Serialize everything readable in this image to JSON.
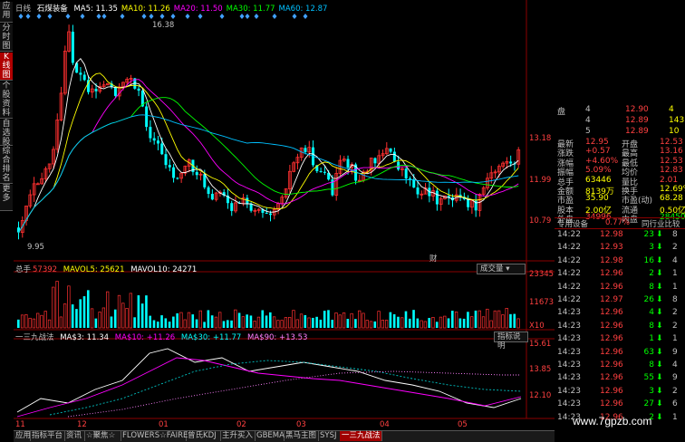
{
  "sidebar": {
    "tabs": [
      {
        "label": "应用",
        "active": false
      },
      {
        "label": "分时图",
        "active": false
      },
      {
        "label": "K线图",
        "active": true
      },
      {
        "label": "个股资料",
        "active": false
      },
      {
        "label": "自选股",
        "active": false
      },
      {
        "label": "综合排名",
        "active": false
      },
      {
        "label": "更多",
        "active": false
      }
    ]
  },
  "main": {
    "period": "日线",
    "stock_name": "石煤装备",
    "ma": [
      {
        "label": "MA5: 11.35",
        "color": "#ffffff"
      },
      {
        "label": "MA10: 11.26",
        "color": "#ffff00"
      },
      {
        "label": "MA20: 11.50",
        "color": "#ff00ff"
      },
      {
        "label": "MA30: 11.77",
        "color": "#00ff00"
      },
      {
        "label": "MA60: 12.87",
        "color": "#00c0ff"
      }
    ],
    "high_label": "16.38",
    "low_label": "9.95",
    "price_axis": [
      "13.18",
      "11.99",
      "10.79"
    ],
    "marker_text": "财"
  },
  "volume": {
    "label": "总手",
    "value": "57392",
    "mavol5": "MAVOL5: 25621",
    "mavol10": "MAVOL10: 24271",
    "dropdown": "成交量",
    "axis": [
      "23345",
      "11673",
      "X10"
    ]
  },
  "indicator": {
    "name": "一三九战法",
    "ma3": "MA$3: 11.34",
    "ma10": "MA$10: +11.26",
    "ma30": "MA$30: +11.77",
    "ma90": "MA$90: +13.53",
    "dropdown": "指标说明",
    "axis": [
      "15.61",
      "13.85",
      "12.10"
    ]
  },
  "time_axis": [
    "11",
    "12",
    "01",
    "02",
    "03",
    "04",
    "05"
  ],
  "bottom_tabs": [
    {
      "label": "应用",
      "active": false
    },
    {
      "label": "指标平台",
      "active": false
    },
    {
      "label": "资讯",
      "active": false
    },
    {
      "label": "☆聚焦☆",
      "active": false
    },
    {
      "label": "FLOWERS☆FAIRE",
      "active": false
    },
    {
      "label": "曾氏KDJ",
      "active": false
    },
    {
      "label": "主升买入",
      "active": false
    },
    {
      "label": "GBEMA",
      "active": false
    },
    {
      "label": "黑马主图",
      "active": false
    },
    {
      "label": "SYSJ",
      "active": false
    },
    {
      "label": "一三九战法",
      "active": true
    }
  ],
  "quote": {
    "orderbook": [
      {
        "label": "盘",
        "num": "4",
        "price": "12.90",
        "vol": "4"
      },
      {
        "label": "",
        "num": "4",
        "price": "12.89",
        "vol": "143"
      },
      {
        "label": "",
        "num": "5",
        "price": "12.89",
        "vol": "10"
      }
    ],
    "rows": [
      {
        "l1": "最新",
        "v1": "12.95",
        "l2": "开盘",
        "v2": "12.53",
        "c1": "#ff4040",
        "c2": "#ff4040"
      },
      {
        "l1": "涨跌",
        "v1": "+0.57",
        "l2": "最高",
        "v2": "13.16",
        "c1": "#ff4040",
        "c2": "#ff4040"
      },
      {
        "l1": "涨幅",
        "v1": "+4.60%",
        "l2": "最低",
        "v2": "12.53",
        "c1": "#ff4040",
        "c2": "#ff4040"
      },
      {
        "l1": "振幅",
        "v1": "5.09%",
        "l2": "均价",
        "v2": "12.83",
        "c1": "#ff4040",
        "c2": "#ff4040"
      },
      {
        "l1": "总手",
        "v1": "63446",
        "l2": "量比",
        "v2": "2.01",
        "c1": "#ffff00",
        "c2": "#ff4040"
      },
      {
        "l1": "金额",
        "v1": "8139万",
        "l2": "换手",
        "v2": "12.69%",
        "c1": "#ffff00",
        "c2": "#ffff00"
      },
      {
        "l1": "市盈",
        "v1": "35.90",
        "l2": "市盈(动)",
        "v2": "68.28",
        "c1": "#ffff00",
        "c2": "#ffff00"
      },
      {
        "l1": "股本",
        "v1": "2.00亿",
        "l2": "流通",
        "v2": "0.50亿",
        "c1": "#ffff00",
        "c2": "#ffff00"
      },
      {
        "l1": "外盘",
        "v1": "34996",
        "l2": "内盘",
        "v2": "28450",
        "c1": "#ff4040",
        "c2": "#00ff00"
      }
    ],
    "tabs": {
      "special": "专用设备",
      "special_pct": "0.77%",
      "compare": "同行业比较"
    },
    "ticks": [
      {
        "time": "14:22",
        "price": "12.98",
        "vol": "23",
        "dir": "down",
        "bs": "8"
      },
      {
        "time": "14:22",
        "price": "12.93",
        "vol": "3",
        "dir": "down",
        "bs": "2"
      },
      {
        "time": "14:22",
        "price": "12.98",
        "vol": "16",
        "dir": "down",
        "bs": "4"
      },
      {
        "time": "14:22",
        "price": "12.96",
        "vol": "2",
        "dir": "down",
        "bs": "1"
      },
      {
        "time": "14:22",
        "price": "12.96",
        "vol": "8",
        "dir": "down",
        "bs": "1"
      },
      {
        "time": "14:22",
        "price": "12.97",
        "vol": "26",
        "dir": "down",
        "bs": "8"
      },
      {
        "time": "14:23",
        "price": "12.96",
        "vol": "4",
        "dir": "down",
        "bs": "2"
      },
      {
        "time": "14:23",
        "price": "12.96",
        "vol": "8",
        "dir": "down",
        "bs": "2"
      },
      {
        "time": "14:23",
        "price": "12.96",
        "vol": "1",
        "dir": "down",
        "bs": "1"
      },
      {
        "time": "14:23",
        "price": "12.96",
        "vol": "63",
        "dir": "down",
        "bs": "9"
      },
      {
        "time": "14:23",
        "price": "12.96",
        "vol": "8",
        "dir": "down",
        "bs": "4"
      },
      {
        "time": "14:23",
        "price": "12.96",
        "vol": "55",
        "dir": "down",
        "bs": "9"
      },
      {
        "time": "14:23",
        "price": "12.96",
        "vol": "3",
        "dir": "down",
        "bs": "2"
      },
      {
        "time": "14:23",
        "price": "12.96",
        "vol": "27",
        "dir": "down",
        "bs": "6"
      },
      {
        "time": "14:23",
        "price": "12.96",
        "vol": "2",
        "dir": "down",
        "bs": "1"
      }
    ]
  },
  "watermark": "www.7gpzb.com"
}
